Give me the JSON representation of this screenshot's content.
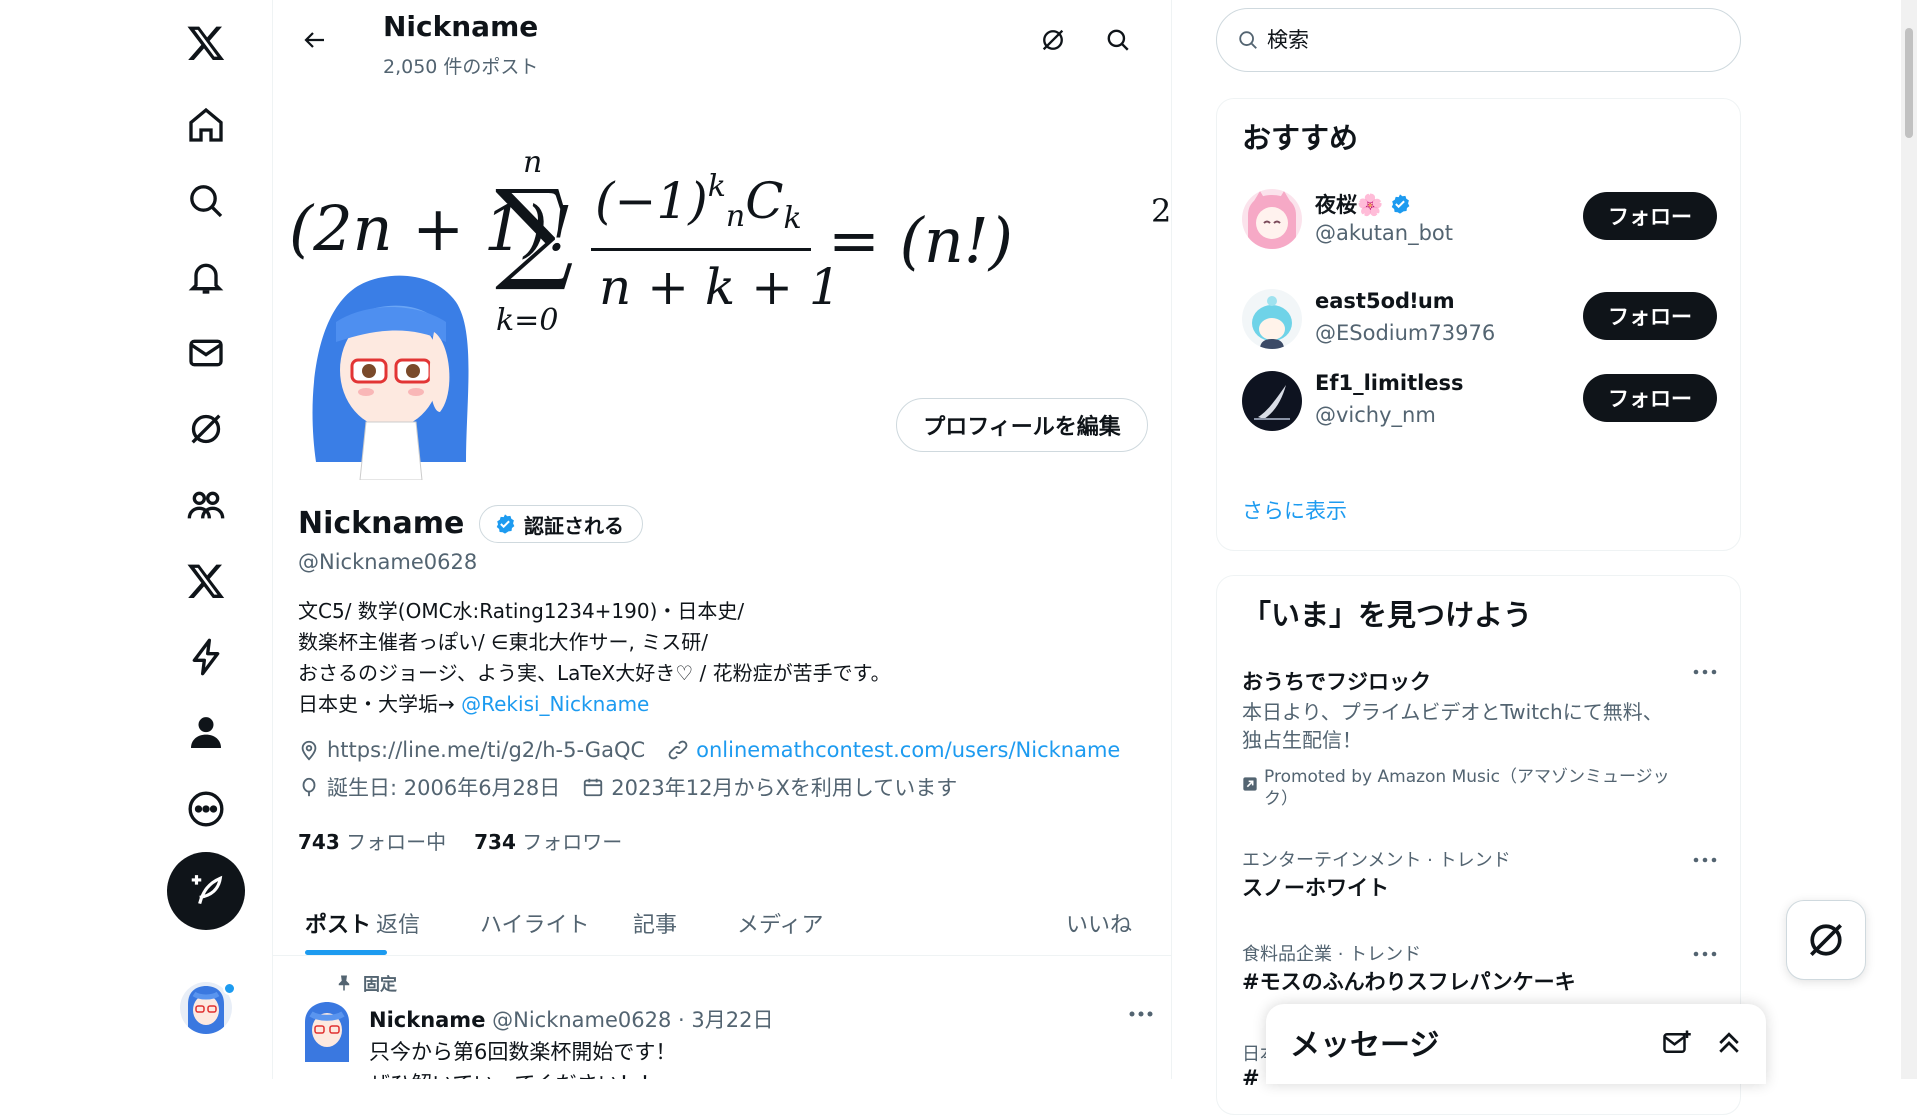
{
  "nav": {
    "items": [
      {
        "icon": "x-logo-icon"
      },
      {
        "icon": "home-icon"
      },
      {
        "icon": "explore-icon"
      },
      {
        "icon": "notifications-icon"
      },
      {
        "icon": "messages-icon"
      },
      {
        "icon": "grok-icon"
      },
      {
        "icon": "communities-icon"
      },
      {
        "icon": "premium-icon"
      },
      {
        "icon": "verified-orgs-icon"
      },
      {
        "icon": "profile-icon"
      },
      {
        "icon": "more-icon"
      }
    ],
    "compose_icon": "compose-post-icon"
  },
  "header": {
    "name": "Nickname",
    "post_count": "2,050 件のポスト"
  },
  "profile": {
    "edit_button": "プロフィールを編集",
    "name": "Nickname",
    "verify_button": "認証される",
    "handle": "@Nickname0628",
    "bio_line1": "文C5/ 数学(OMC水:Rating1234+190)・日本史/",
    "bio_line2": "数楽杯主催者っぽい/ ∈東北大作サー, ミス研/",
    "bio_line3": "おさるのジョージ、よう実、LaTeX大好き♡ / 花粉症が苦手です。",
    "bio_line4_prefix": "日本史・大学垢→ ",
    "bio_mention": "@Rekisi_Nickname",
    "location": "https://line.me/ti/g2/h-5-GaQC",
    "website": "onlinemathcontest.com/users/Nickname",
    "birthday": "誕生日: 2006年6月28日",
    "joined": "2023年12月からXを利用しています",
    "following_count": "743",
    "following_label": "フォロー中",
    "followers_count": "734",
    "followers_label": "フォロワー"
  },
  "tabs": [
    "ポスト",
    "返信",
    "ハイライト",
    "記事",
    "メディア",
    "いいね"
  ],
  "pinned_post": {
    "pinned_label": "固定",
    "name": "Nickname",
    "meta": "@Nickname0628 · 3月22日",
    "line1": "只今から第6回数楽杯開始です！",
    "line2": "ぜひ解いていってください！！"
  },
  "search": {
    "placeholder": "検索"
  },
  "recommendations": {
    "title": "おすすめ",
    "users": [
      {
        "name": "夜桜🌸",
        "handle": "@akutan_bot",
        "verified": true
      },
      {
        "name": "east5odǃum",
        "handle": "@ESodium73976",
        "verified": false
      },
      {
        "name": "Ef1_limitless",
        "handle": "@vichy_nm",
        "verified": false
      }
    ],
    "follow_label": "フォロー",
    "show_more": "さらに表示"
  },
  "trends": {
    "title": "「いま」を見つけよう",
    "items": [
      {
        "title": "おうちでフジロック",
        "desc1": "本日より、プライムビデオとTwitchにて無料、",
        "desc2": "独占生配信！",
        "promoted1": "Promoted by Amazon Music（アマゾンミュージッ",
        "promoted2": "ク）"
      },
      {
        "category": "エンターテインメント · トレンド",
        "title": "スノーホワイト"
      },
      {
        "category": "食料品企業 · トレンド",
        "title": "#モスのふんわりスフレパンケーキ"
      },
      {
        "category": "日本",
        "title": "#"
      }
    ]
  },
  "messages": {
    "title": "メッセージ"
  },
  "colors": {
    "accent": "#1d9bf0",
    "text": "#0f1419",
    "muted": "#536471",
    "button": "#0f1419"
  }
}
